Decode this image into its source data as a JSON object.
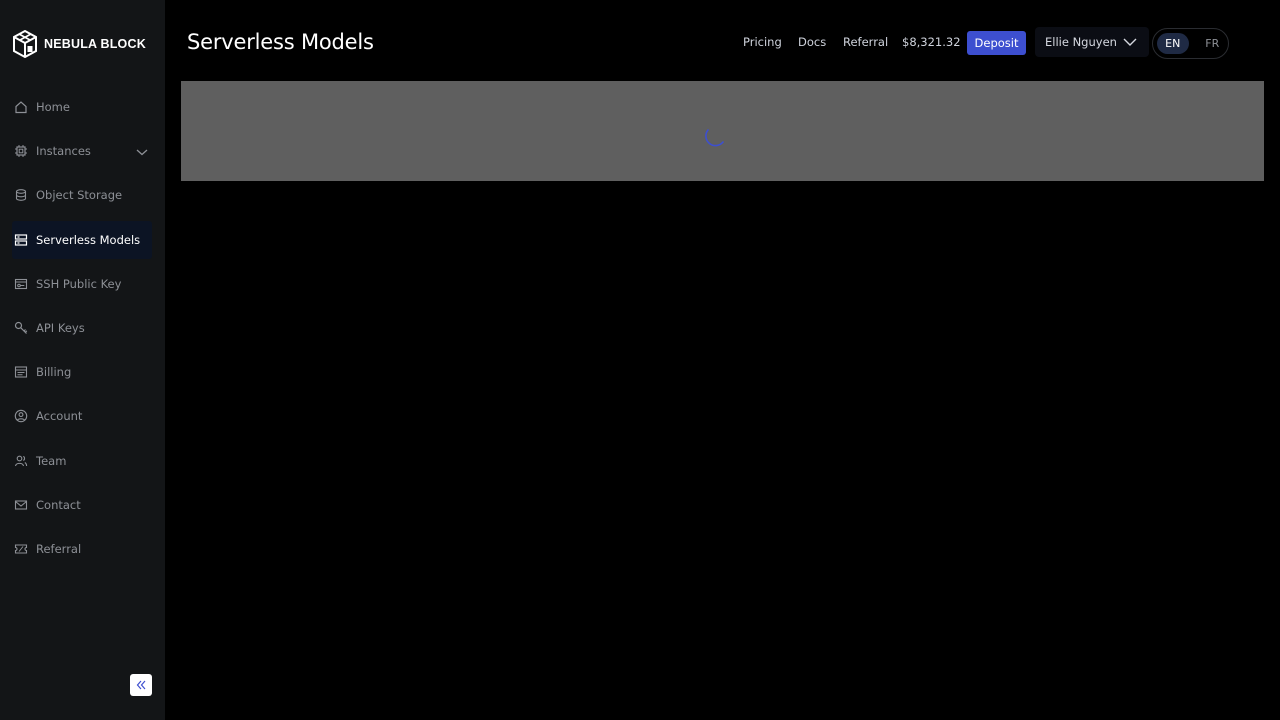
{
  "brand": {
    "name": "NEBULA BLOCK"
  },
  "sidebar": {
    "items": [
      {
        "label": "Home",
        "icon": "home-icon"
      },
      {
        "label": "Instances",
        "icon": "chip-icon"
      },
      {
        "label": "Object Storage",
        "icon": "database-icon"
      },
      {
        "label": "Serverless Models",
        "icon": "server-icon",
        "active": true
      },
      {
        "label": "SSH Public Key",
        "icon": "key-card-icon"
      },
      {
        "label": "API Keys",
        "icon": "key-icon"
      },
      {
        "label": "Billing",
        "icon": "billing-icon"
      },
      {
        "label": "Account",
        "icon": "user-circle-icon"
      },
      {
        "label": "Team",
        "icon": "team-icon"
      },
      {
        "label": "Contact",
        "icon": "mail-icon"
      },
      {
        "label": "Referral",
        "icon": "ticket-icon"
      }
    ]
  },
  "header": {
    "title": "Serverless Models",
    "links": {
      "pricing": "Pricing",
      "docs": "Docs",
      "referral": "Referral"
    },
    "balance": "$8,321.32",
    "deposit_label": "Deposit",
    "user_name": "Ellie Nguyen",
    "languages": {
      "en": "EN",
      "fr": "FR",
      "selected": "EN"
    }
  },
  "colors": {
    "accent": "#3d4fd0",
    "sidebar_bg": "#131517",
    "active_item_bg": "#0c1424",
    "loading_panel_bg": "#5f5f5f"
  }
}
